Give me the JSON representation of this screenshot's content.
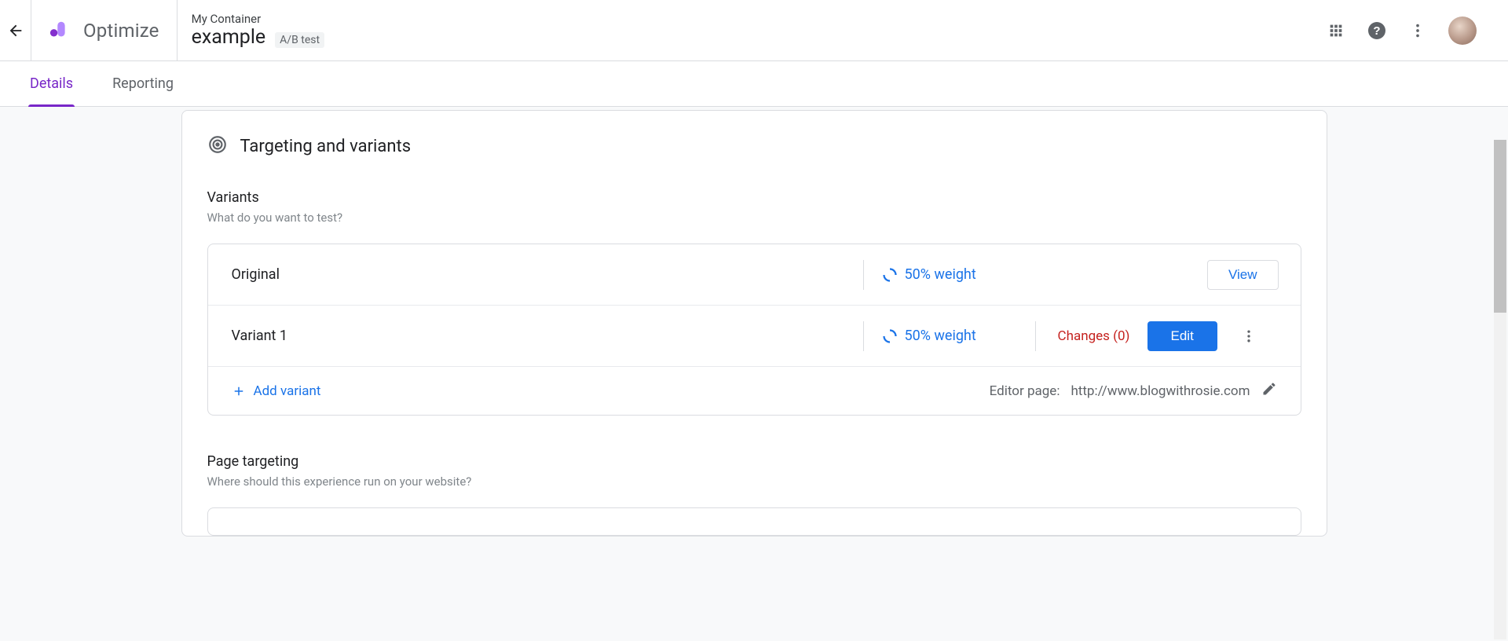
{
  "header": {
    "product_name": "Optimize",
    "container_name": "My Container",
    "experiment_name": "example",
    "experiment_type_badge": "A/B test"
  },
  "tabs": {
    "details": "Details",
    "reporting": "Reporting"
  },
  "panel": {
    "title": "Targeting and variants",
    "variants": {
      "heading": "Variants",
      "sub": "What do you want to test?",
      "rows": [
        {
          "name": "Original",
          "weight": "50% weight",
          "view_label": "View"
        },
        {
          "name": "Variant 1",
          "weight": "50% weight",
          "changes": "Changes (0)",
          "edit_label": "Edit"
        }
      ],
      "add_label": "Add variant",
      "editor_prefix": "Editor page:",
      "editor_url": "http://www.blogwithrosie.com"
    },
    "page_targeting": {
      "heading": "Page targeting",
      "sub": "Where should this experience run on your website?"
    }
  }
}
